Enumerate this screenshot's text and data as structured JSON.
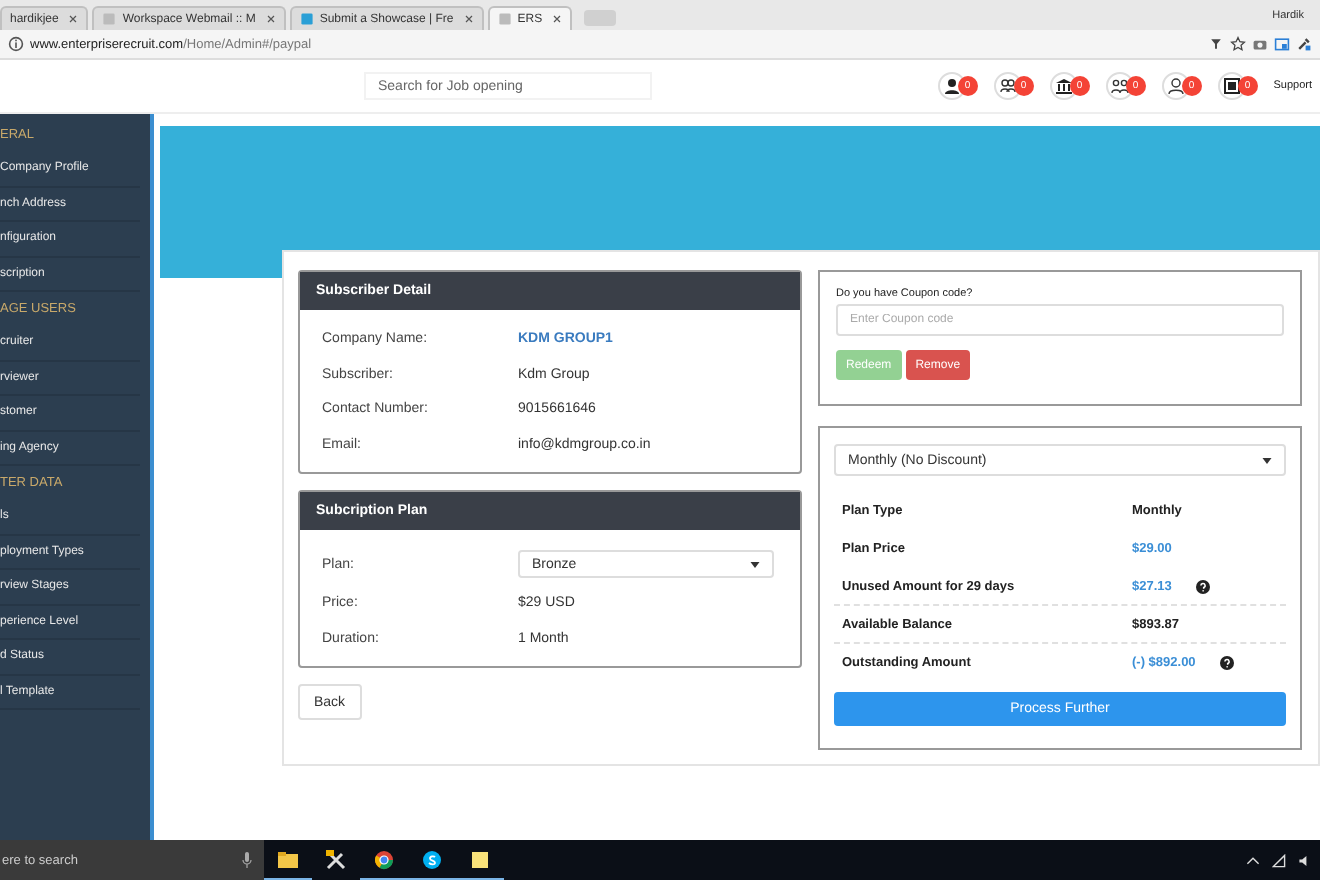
{
  "browser": {
    "tabs": [
      {
        "title": "hardikjee",
        "selected": false
      },
      {
        "title": "Workspace Webmail :: M",
        "selected": false
      },
      {
        "title": "Submit a Showcase | Fre",
        "selected": false
      },
      {
        "title": "ERS",
        "selected": true
      }
    ],
    "user": "Hardik",
    "url_host": "www.enterpriserecruit.com",
    "url_path": "/Home/Admin#/paypal"
  },
  "header": {
    "search": {
      "placeholder": "Search for Job opening"
    },
    "badges": [
      "0",
      "0",
      "0",
      "0",
      "0",
      "0"
    ],
    "support": "Support"
  },
  "sidebar": {
    "sections": [
      {
        "heading": "ERAL",
        "items": [
          "Company Profile",
          "nch Address",
          "nfiguration",
          "scription"
        ]
      },
      {
        "heading": "AGE USERS",
        "items": [
          "cruiter",
          "rviewer",
          "stomer",
          "ing Agency"
        ]
      },
      {
        "heading": "TER DATA",
        "items": [
          "ls",
          "ployment Types",
          "rview Stages",
          "perience Level",
          "d Status",
          "l Template"
        ]
      }
    ]
  },
  "subscriber": {
    "title": "Subscriber Detail",
    "rows": [
      {
        "label": "Company Name:",
        "value": "KDM GROUP1",
        "kind": "link"
      },
      {
        "label": "Subscriber:",
        "value": "Kdm Group",
        "kind": "plain"
      },
      {
        "label": "Contact Number:",
        "value": "9015661646",
        "kind": "plain"
      },
      {
        "label": "Email:",
        "value": "info@kdmgroup.co.in",
        "kind": "plain"
      }
    ]
  },
  "plan": {
    "title": "Subcription Plan",
    "plan_label": "Plan:",
    "plan_value": "Bronze",
    "rows": [
      {
        "label": "Price:",
        "value": "$29 USD"
      },
      {
        "label": "Duration:",
        "value": "1 Month"
      }
    ]
  },
  "back": "Back",
  "coupon": {
    "label": "Do you have Coupon code?",
    "placeholder": "Enter Coupon code",
    "redeem": "Redeem",
    "redeem_disabled": true,
    "remove": "Remove"
  },
  "billing": {
    "period": "Monthly (No Discount)",
    "rows": [
      {
        "label": "Plan Type",
        "value": "Monthly",
        "kind": "plain",
        "info": false,
        "divider": false
      },
      {
        "label": "Plan Price",
        "value": "$29.00",
        "kind": "link",
        "info": false,
        "divider": false
      },
      {
        "label": "Unused Amount for 29 days",
        "value": "$27.13",
        "kind": "link",
        "info": true,
        "divider": false
      },
      {
        "label": "Available Balance",
        "value": "$893.87",
        "kind": "plain",
        "info": false,
        "divider": true
      },
      {
        "label": "Outstanding Amount",
        "value": "(-) $892.00",
        "kind": "link",
        "info": true,
        "divider": true
      }
    ],
    "submit": "Process Further"
  },
  "taskbar": {
    "search": "ere to search"
  }
}
